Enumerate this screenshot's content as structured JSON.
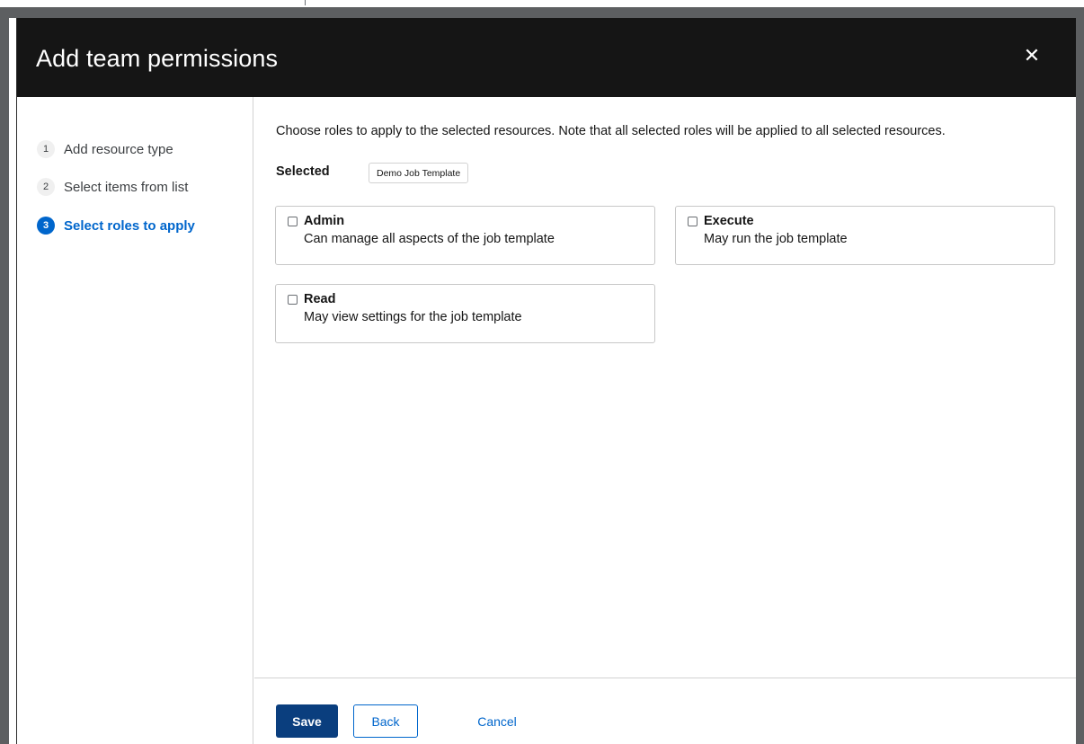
{
  "modal": {
    "title": "Add team permissions",
    "close_icon": "close-icon"
  },
  "wizard": {
    "steps": [
      {
        "number": "1",
        "label": "Add resource type",
        "current": false
      },
      {
        "number": "2",
        "label": "Select items from list",
        "current": false
      },
      {
        "number": "3",
        "label": "Select roles to apply",
        "current": true
      }
    ]
  },
  "main": {
    "instructions": "Choose roles to apply to the selected resources. Note that all selected roles will be applied to all selected resources.",
    "selected_label": "Selected",
    "selected_chip": "Demo Job Template",
    "roles": [
      {
        "name": "Admin",
        "description": "Can manage all aspects of the job template",
        "checked": false
      },
      {
        "name": "Execute",
        "description": "May run the job template",
        "checked": false
      },
      {
        "name": "Read",
        "description": "May view settings for the job template",
        "checked": false
      }
    ]
  },
  "footer": {
    "save_label": "Save",
    "back_label": "Back",
    "cancel_label": "Cancel"
  },
  "colors": {
    "header_bg": "#151515",
    "accent": "#0066cc",
    "primary_button": "#0a3e7e"
  }
}
